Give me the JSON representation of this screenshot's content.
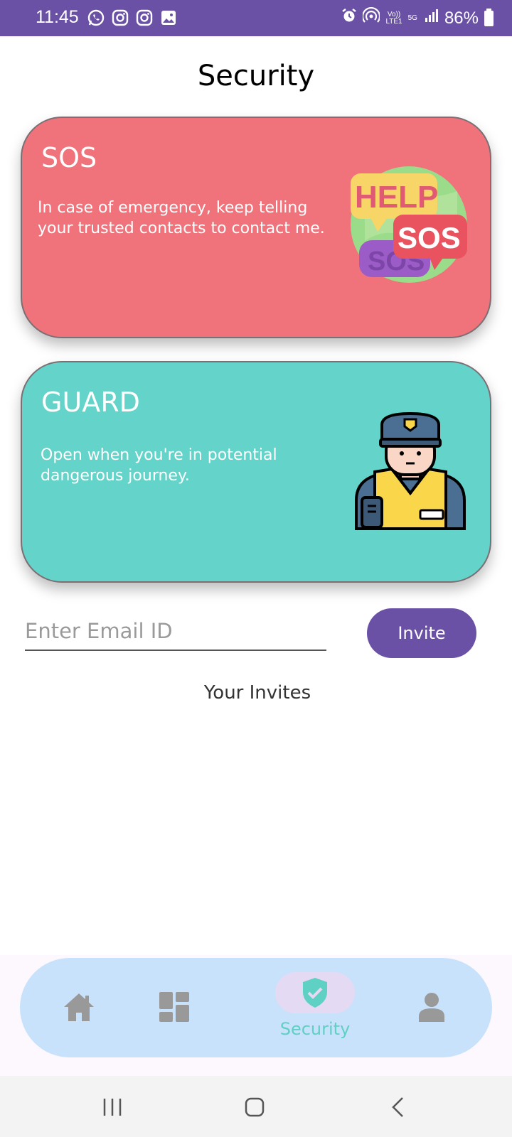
{
  "status_bar": {
    "time": "11:45",
    "left_icons": [
      "whatsapp-icon",
      "instagram-icon",
      "instagram-icon",
      "gallery-icon"
    ],
    "network_top": "Vo))",
    "network_bottom": "LTE1",
    "network_5g": "5G",
    "battery": "86%"
  },
  "page": {
    "title": "Security"
  },
  "cards": {
    "sos": {
      "title": "SOS",
      "description": "In case of emergency, keep telling your trusted contacts to contact me.",
      "art_help": "HELP",
      "art_sos": "SOS",
      "color": "#f0727a"
    },
    "guard": {
      "title": "GUARD",
      "description": "Open when you're in potential dangerous journey.",
      "color": "#64d3c9"
    }
  },
  "invite": {
    "email_placeholder": "Enter Email ID",
    "email_value": "",
    "button_label": "Invite"
  },
  "invites_section": {
    "heading": "Your Invites"
  },
  "bottom_nav": {
    "items": [
      {
        "icon": "home-icon",
        "label": ""
      },
      {
        "icon": "dashboard-icon",
        "label": ""
      },
      {
        "icon": "shield-check-icon",
        "label": "Security",
        "active": true
      },
      {
        "icon": "person-icon",
        "label": ""
      }
    ],
    "active_color": "#5fd0c4",
    "bar_color": "#c8e2fb"
  },
  "system_nav": [
    "recent-apps-icon",
    "home-icon",
    "back-icon"
  ],
  "colors": {
    "accent": "#6a51a6"
  }
}
